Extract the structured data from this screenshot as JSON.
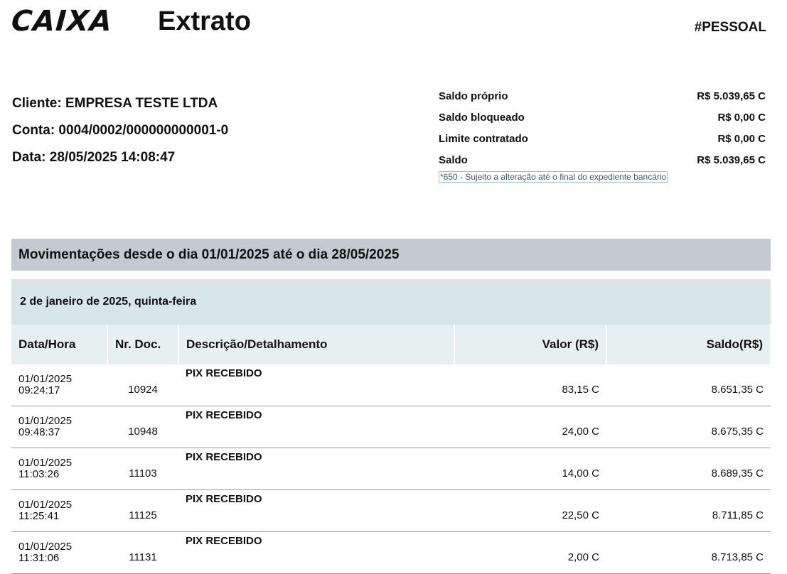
{
  "header": {
    "logo_text": "CAIXA",
    "title": "Extrato",
    "tag": "#PESSOAL"
  },
  "client": {
    "cliente": "Cliente: EMPRESA TESTE LTDA",
    "conta": "Conta: 0004/0002/000000000001-0",
    "data": "Data: 28/05/2025 14:08:47"
  },
  "balances": [
    {
      "label": "Saldo próprio",
      "value": "R$ 5.039,65 C"
    },
    {
      "label": "Saldo bloqueado",
      "value": "R$ 0,00 C"
    },
    {
      "label": "Limite contratado",
      "value": "R$ 0,00 C"
    },
    {
      "label": "Saldo",
      "value": "R$ 5.039,65 C"
    }
  ],
  "balance_note": "*650 - Sujeito a alteração até o final do expediente bancário",
  "period_title": "Movimentações desde o dia 01/01/2025 até o dia 28/05/2025",
  "day_title": "2 de janeiro de 2025, quinta-feira",
  "table": {
    "headers": [
      "Data/Hora",
      "Nr. Doc.",
      "Descrição/Detalhamento",
      "Valor (R$)",
      "Saldo(R$)"
    ],
    "rows": [
      {
        "date": "01/01/2025",
        "time": "09:24:17",
        "doc": "10924",
        "desc": "PIX RECEBIDO",
        "valor": "83,15 C",
        "saldo": "8.651,35 C"
      },
      {
        "date": "01/01/2025",
        "time": "09:48:37",
        "doc": "10948",
        "desc": "PIX RECEBIDO",
        "valor": "24,00 C",
        "saldo": "8.675,35 C"
      },
      {
        "date": "01/01/2025",
        "time": "11:03:26",
        "doc": "11103",
        "desc": "PIX RECEBIDO",
        "valor": "14,00 C",
        "saldo": "8.689,35 C"
      },
      {
        "date": "01/01/2025",
        "time": "11:25:41",
        "doc": "11125",
        "desc": "PIX RECEBIDO",
        "valor": "22,50 C",
        "saldo": "8.711,85 C"
      },
      {
        "date": "01/01/2025",
        "time": "11:31:06",
        "doc": "11131",
        "desc": "PIX RECEBIDO",
        "valor": "2,00 C",
        "saldo": "8.713,85 C"
      }
    ]
  }
}
